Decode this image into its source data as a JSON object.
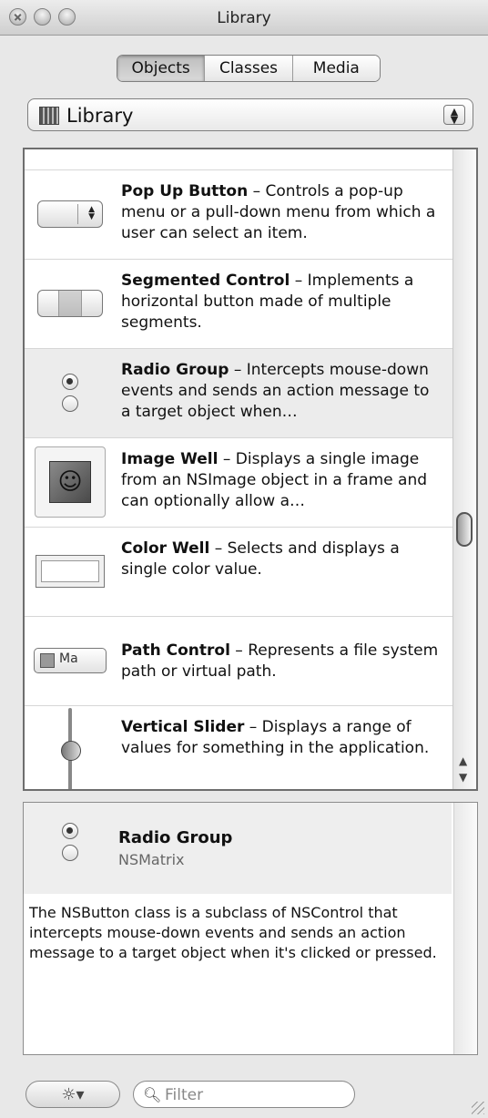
{
  "window": {
    "title": "Library"
  },
  "tabs": [
    {
      "label": "Objects",
      "active": true
    },
    {
      "label": "Classes",
      "active": false
    },
    {
      "label": "Media",
      "active": false
    }
  ],
  "library_popup": {
    "selected": "Library"
  },
  "items": [
    {
      "name": "Pop Up Button",
      "desc": " – Controls a pop-up menu or a pull-down menu from which a user can select an item.",
      "icon": "popup-button-icon"
    },
    {
      "name": "Segmented Control",
      "desc": " – Implements a horizontal button made of multiple segments.",
      "icon": "segmented-control-icon"
    },
    {
      "name": "Radio Group",
      "desc": " – Intercepts mouse-down events and sends an action message to a target object when…",
      "icon": "radio-group-icon",
      "selected": true
    },
    {
      "name": "Image Well",
      "desc": " – Displays a single image from an NSImage object in a frame and can optionally allow a…",
      "icon": "image-well-icon"
    },
    {
      "name": "Color Well",
      "desc": " – Selects and displays a single color value.",
      "icon": "color-well-icon"
    },
    {
      "name": "Path Control",
      "desc": " – Represents a file system path or virtual path.",
      "icon": "path-control-icon",
      "icon_text": "Ma"
    },
    {
      "name": "Vertical Slider",
      "desc": " – Displays a range of values for something in the application.",
      "icon": "vertical-slider-icon"
    }
  ],
  "detail": {
    "name": "Radio Group",
    "class_name": "NSMatrix",
    "description": "The NSButton class is a subclass of NSControl that intercepts mouse-down events and sends an action message to a target object when it's clicked or pressed."
  },
  "bottom": {
    "gear": "☼▾",
    "filter_placeholder": "Filter"
  }
}
